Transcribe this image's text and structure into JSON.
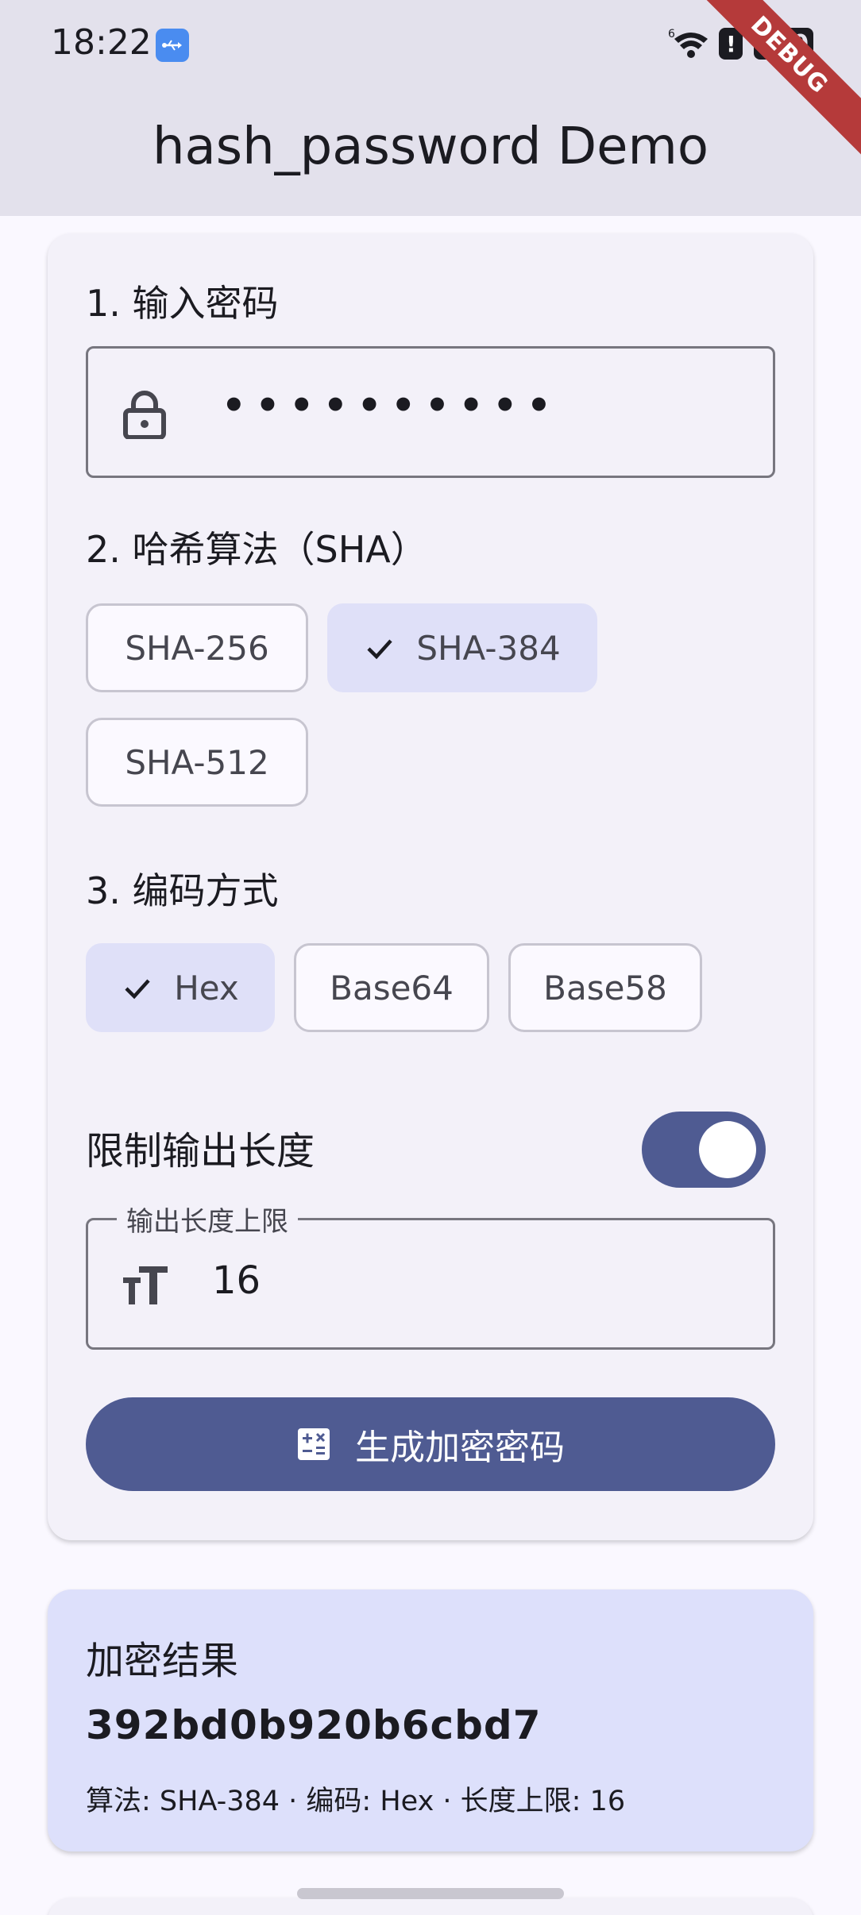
{
  "status_bar": {
    "time": "18:22",
    "signal_label": "6",
    "battery": "100",
    "alert": "!",
    "usb_icon": "usb-icon"
  },
  "debug_banner": "DEBUG",
  "app_bar": {
    "title": "hash_password Demo"
  },
  "form": {
    "password_section_title": "1. 输入密码",
    "password_masked": "••••••••••",
    "password_icon": "lock-icon",
    "algorithm_section_title": "2. 哈希算法（SHA）",
    "algorithms": [
      {
        "label": "SHA-256",
        "selected": false
      },
      {
        "label": "SHA-384",
        "selected": true
      },
      {
        "label": "SHA-512",
        "selected": false
      }
    ],
    "encoding_section_title": "3. 编码方式",
    "encodings": [
      {
        "label": "Hex",
        "selected": true
      },
      {
        "label": "Base64",
        "selected": false
      },
      {
        "label": "Base58",
        "selected": false
      }
    ],
    "limit_toggle_label": "限制输出长度",
    "limit_toggle_on": true,
    "max_length_label": "输出长度上限",
    "max_length_value": "16",
    "max_length_icon": "text-size-icon",
    "generate_button_label": "生成加密密码",
    "generate_button_icon": "calculate-icon"
  },
  "result": {
    "title": "加密结果",
    "value": "392bd0b920b6cbd7",
    "meta": "算法: SHA-384 · 编码: Hex · 长度上限: 16"
  },
  "colors": {
    "primary": "#4f5b92",
    "app_bar_bg": "#e3e1ec",
    "card_bg": "#f3f1f9",
    "result_bg": "#dde0fb",
    "chip_selected_bg": "#dfe0f8"
  }
}
